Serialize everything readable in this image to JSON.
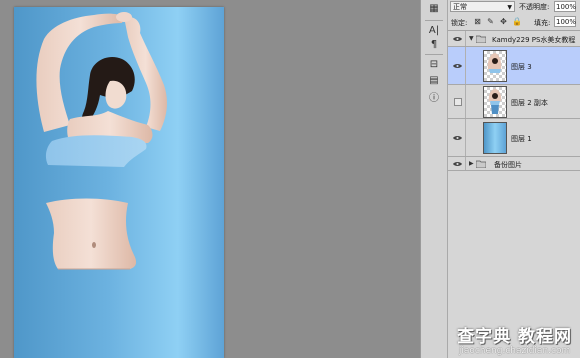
{
  "document": {
    "image_subject": "woman-arms-raised-body-split"
  },
  "tools": {
    "icons": [
      "history-icon",
      "character-icon",
      "paragraph-icon",
      "clone-source-icon",
      "channels-icon",
      "info-icon"
    ]
  },
  "layers_panel": {
    "blend_mode": "正常",
    "opacity_label": "不透明度:",
    "opacity_value": "100%",
    "lock_label": "锁定:",
    "fill_label": "填充:",
    "fill_value": "100%",
    "group_open": {
      "name": "Kamdy229 PS水美女教程",
      "visible": true
    },
    "layers": [
      {
        "name": "图层 3",
        "visible": true,
        "selected": true,
        "thumb": "woman-upper"
      },
      {
        "name": "图层 2 副本",
        "visible": false,
        "selected": false,
        "thumb": "woman-full"
      },
      {
        "name": "图层 1",
        "visible": true,
        "selected": false,
        "thumb": "blue-gradient"
      }
    ],
    "group_closed": {
      "name": "备份图片",
      "visible": true
    }
  },
  "watermark": {
    "main": "查字典 教程网",
    "sub": "jiaocheng.chazidian.com"
  }
}
